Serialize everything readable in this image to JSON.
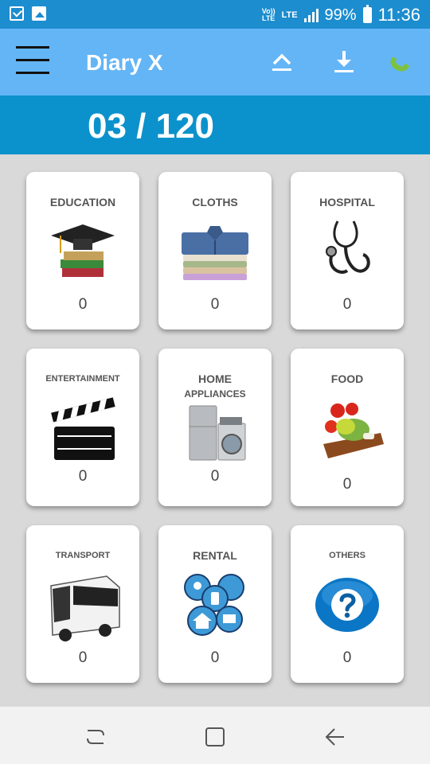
{
  "status_bar": {
    "volte_top": "Vo))",
    "volte_bottom": "LTE",
    "lte_label": "LTE",
    "battery_percent": "99%",
    "time": "11:36"
  },
  "app_bar": {
    "title": "Diary X",
    "icons": [
      "menu-icon",
      "upload-icon",
      "download-icon",
      "phone-icon"
    ]
  },
  "counter": {
    "text": "03 / 120"
  },
  "categories": [
    {
      "label": "EDUCATION",
      "count": "0",
      "icon": "graduation-books-icon"
    },
    {
      "label": "CLOTHS",
      "count": "0",
      "icon": "shirts-icon"
    },
    {
      "label": "HOSPITAL",
      "count": "0",
      "icon": "stethoscope-icon"
    },
    {
      "label": "ENTERTAINMENT",
      "count": "0",
      "icon": "clapperboard-icon"
    },
    {
      "label": "HOME",
      "label_line2": "APPLIANCES",
      "count": "0",
      "icon": "appliances-icon"
    },
    {
      "label": "FOOD",
      "count": "0",
      "icon": "vegetables-icon"
    },
    {
      "label": "TRANSPORT",
      "count": "0",
      "icon": "bus-icon"
    },
    {
      "label": "RENTAL",
      "count": "0",
      "icon": "rental-bubbles-icon"
    },
    {
      "label": "OTHERS",
      "count": "0",
      "icon": "question-icon"
    }
  ],
  "colors": {
    "status_bar": "#1c8dcf",
    "app_bar": "#64b5f6",
    "counter_bar": "#0b92cc",
    "background": "#d9d9d9"
  }
}
